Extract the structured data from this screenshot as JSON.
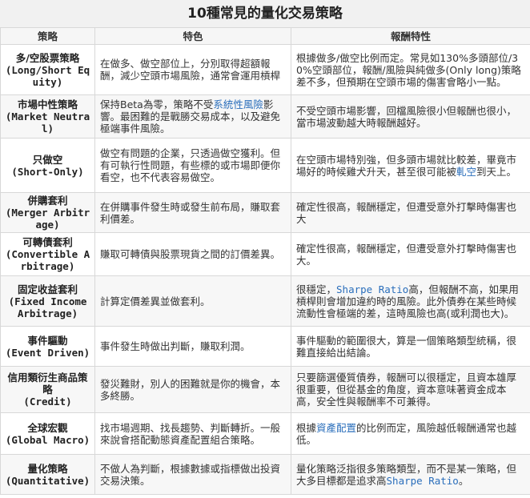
{
  "title": "10種常見的量化交易策略",
  "headers": {
    "strategy": "策略",
    "features": "特色",
    "returns": "報酬特性"
  },
  "rows": [
    {
      "name_zh": "多/空股票策略",
      "name_en": "(Long/Short Equity)",
      "features": "在做多、做空部位上，分別取得超額報酬，減少空頭市場風險，通常會運用槓桿",
      "returns": "根據做多/做空比例而定。常見如130%多頭部位/30%空頭部位，報酬/風險與純做多(Only long)策略差不多，但預期在空頭市場的傷害會略小一點。"
    },
    {
      "name_zh": "市場中性策略",
      "name_en": "(Market Neutral)",
      "features_pre": "保持Beta為零，策略不受",
      "features_link": "系統性風險",
      "features_post": "影響。最困難的是戰勝交易成本，以及避免極端事件風險。",
      "returns": "不受空頭市場影響，回檔風險很小但報酬也很小，當市場波動越大時報酬越好。"
    },
    {
      "name_zh": "只做空",
      "name_en": "(Short-Only)",
      "features": "做空有問題的企業，只透過做空獲利。但有可執行性問題，有些標的或市場即便你看空，也不代表容易做空。",
      "returns_pre": "在空頭市場特別強，但多頭市場就比較差，畢竟市場好的時候雞犬升天，甚至很可能被",
      "returns_link": "軋空",
      "returns_post": "到天上。"
    },
    {
      "name_zh": "併購套利",
      "name_en": "(Merger Arbitrage)",
      "features": "在併購事件發生時或發生前布局，賺取套利價差。",
      "returns": "確定性很高，報酬穩定，但遭受意外打擊時傷害也大"
    },
    {
      "name_zh": "可轉債套利",
      "name_en": "(Convertible Arbitrage)",
      "features": "賺取可轉債與股票現貨之間的訂價差異。",
      "returns": "確定性很高，報酬穩定，但遭受意外打擊時傷害也大。"
    },
    {
      "name_zh": "固定收益套利",
      "name_en": "(Fixed Income Arbitrage)",
      "features": "計算定價差異並做套利。",
      "returns_pre": "很穩定，",
      "returns_link": "Sharpe Ratio",
      "returns_post": "高，但報酬不高，如果用槓桿則會增加違約時的風險。此外債券在某些時候流動性會極端的差，這時風險也高(或利潤也大)。"
    },
    {
      "name_zh": "事件驅動",
      "name_en": "(Event Driven)",
      "features": "事件發生時做出判斷，賺取利潤。",
      "returns": "事件驅動的範圍很大，算是一個策略類型統稱，很難直接給出結論。"
    },
    {
      "name_zh": "信用類衍生商品策略",
      "name_en": "(Credit)",
      "features": "發災難財，別人的困難就是你的機會，本多終勝。",
      "returns": "只要篩選優質債券，報酬可以很穩定，且資本雄厚很重要，但從基金的角度，資本意味著資金成本高，安全性與報酬率不可兼得。"
    },
    {
      "name_zh": "全球宏觀",
      "name_en": "(Global Macro)",
      "features": "找市場週期、找長趨勢、判斷轉折。一般來說會搭配動態資產配置組合策略。",
      "returns_pre": "根據",
      "returns_link": "資產配置",
      "returns_post": "的比例而定，風險越低報酬通常也越低。"
    },
    {
      "name_zh": "量化策略",
      "name_en": "(Quantitative)",
      "features": "不做人為判斷，根據數據或指標做出投資交易決策。",
      "returns_pre": "量化策略泛指很多策略類型，而不是某一策略，但大多目標都是追求高",
      "returns_link": "Sharpe Ratio",
      "returns_post": "。"
    }
  ],
  "colors": {
    "link": "#2a6ebb",
    "header_bg": "#f6f6f6",
    "title_bg": "#f1f1f1",
    "border": "#d8d8d8"
  }
}
